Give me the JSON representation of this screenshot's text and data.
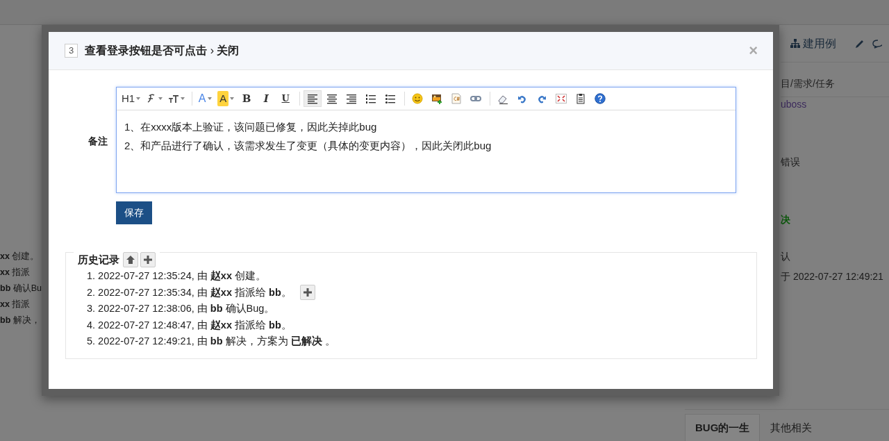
{
  "page_behind": {
    "left_lines": [
      "**xx** 创建。",
      "**xx** 指派",
      "**bb** 确认Bu",
      "**xx** 指派",
      "**bb** 解决，"
    ],
    "right_toolbar": {
      "case_link": "建用例"
    },
    "right_lines": [
      {
        "kind": "heading",
        "text": "目/需求/任务"
      },
      {
        "kind": "link",
        "text": "uboss"
      },
      {
        "kind": "plain",
        "text": "错误"
      },
      {
        "kind": "status",
        "text": "决"
      },
      {
        "kind": "plain",
        "text": "认"
      },
      {
        "kind": "plain",
        "text": "于 2022-07-27 12:49:21"
      }
    ],
    "tabs": [
      {
        "label": "BUG的一生",
        "selected": true
      },
      {
        "label": "其他相关",
        "selected": false
      }
    ]
  },
  "modal": {
    "number": "3",
    "title": "查看登录按钮是否可点击",
    "action": "关闭",
    "separator": "›",
    "close": "×",
    "form": {
      "label": "备注",
      "toolbar": [
        {
          "kind": "heading",
          "label": "H1",
          "dropdown": true
        },
        {
          "kind": "fontfamily",
          "dropdown": true
        },
        {
          "kind": "fontsize",
          "dropdown": true
        },
        {
          "kind": "separator"
        },
        {
          "kind": "color",
          "label": "A",
          "dropdown": true
        },
        {
          "kind": "highlight",
          "label": "A",
          "dropdown": true
        },
        {
          "kind": "bold",
          "label": "B"
        },
        {
          "kind": "italic",
          "label": "I"
        },
        {
          "kind": "underline",
          "label": "U"
        },
        {
          "kind": "separator"
        },
        {
          "kind": "alignleft",
          "selected": true
        },
        {
          "kind": "aligncenter",
          "selected": false
        },
        {
          "kind": "alignright",
          "selected": false
        },
        {
          "kind": "orderedlist"
        },
        {
          "kind": "bulletlist"
        },
        {
          "kind": "separator"
        },
        {
          "kind": "emoji"
        },
        {
          "kind": "image"
        },
        {
          "kind": "code"
        },
        {
          "kind": "link"
        },
        {
          "kind": "separator"
        },
        {
          "kind": "eraser"
        },
        {
          "kind": "undo"
        },
        {
          "kind": "redo"
        },
        {
          "kind": "fullscreen"
        },
        {
          "kind": "paste"
        },
        {
          "kind": "help"
        }
      ],
      "content": [
        "1、在xxxx版本上验证，该问题已修复，因此关掉此bug",
        "2、和产品进行了确认，该需求发生了变更（具体的变更内容），因此关闭此bug"
      ],
      "save": "保存"
    },
    "history": {
      "title": "历史记录",
      "items": [
        {
          "number": "1.",
          "text": "2022-07-27 12:35:24, 由 **赵xx** 创建。",
          "expandable": false
        },
        {
          "number": "2.",
          "text": "2022-07-27 12:35:34, 由 **赵xx** 指派给 **bb**。",
          "expandable": true
        },
        {
          "number": "3.",
          "text": "2022-07-27 12:38:06, 由 **bb** 确认Bug。",
          "expandable": false
        },
        {
          "number": "4.",
          "text": "2022-07-27 12:48:47, 由 **赵xx** 指派给 **bb**。",
          "expandable": false
        },
        {
          "number": "5.",
          "text": "2022-07-27 12:49:21, 由 **bb** 解决，方案为 **已解决** 。",
          "expandable": false
        }
      ]
    }
  }
}
